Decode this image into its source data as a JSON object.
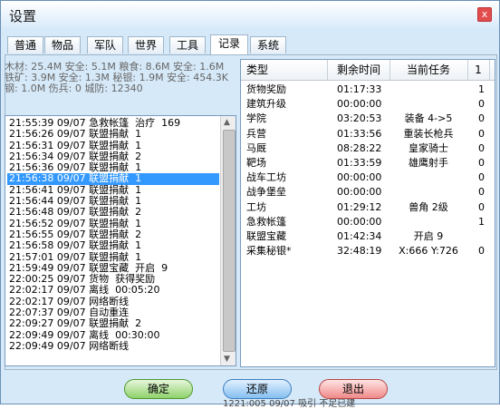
{
  "window": {
    "title": "设置",
    "close_glyph": "x"
  },
  "tabs": [
    {
      "label": "普通",
      "active": false
    },
    {
      "label": "物品",
      "active": false
    },
    {
      "label": "军队",
      "active": false
    },
    {
      "label": "世界",
      "active": false
    },
    {
      "label": "工具",
      "active": false
    },
    {
      "label": "记录",
      "active": true
    },
    {
      "label": "系统",
      "active": false
    }
  ],
  "stats": {
    "line1": "木材: 25.4M 安全: 5.1M  粮食: 8.6M 安全: 1.6M",
    "line2": "铁矿: 3.9M 安全: 1.3M  秘银: 1.9M 安全: 454.3K",
    "line3": "钢: 1.0M  伤兵: 0  城防: 12340"
  },
  "log": {
    "selected_index": 5,
    "entries": [
      "21:55:39 09/07 急救帐篷  治疗  169",
      "21:56:26 09/07 联盟捐献  1",
      "21:56:31 09/07 联盟捐献  1",
      "21:56:34 09/07 联盟捐献  2",
      "21:56:36 09/07 联盟捐献  1",
      "21:56:38 09/07 联盟捐献  1",
      "21:56:41 09/07 联盟捐献  1",
      "21:56:44 09/07 联盟捐献  1",
      "21:56:48 09/07 联盟捐献  2",
      "21:56:52 09/07 联盟捐献  1",
      "21:56:55 09/07 联盟捐献  2",
      "21:56:58 09/07 联盟捐献  1",
      "21:57:01 09/07 联盟捐献  1",
      "21:59:49 09/07 联盟宝藏  开启  9",
      "22:00:25 09/07 货物  获得奖励",
      "22:02:17 09/07 离线  00:05:20",
      "22:02:17 09/07 网络断线",
      "22:07:37 09/07 自动重连",
      "22:09:27 09/07 联盟捐献  2",
      "22:09:49 09/07 离线  00:30:00",
      "22:09:49 09/07 网络断线"
    ]
  },
  "tasks": {
    "headers": [
      "类型",
      "剩余时间",
      "当前任务",
      "1"
    ],
    "rows": [
      {
        "type": "货物奖励",
        "time": "01:17:33",
        "task": "",
        "n": "1"
      },
      {
        "type": "建筑升级",
        "time": "00:00:00",
        "task": "",
        "n": "0"
      },
      {
        "type": "学院",
        "time": "03:20:53",
        "task": "装备 4->5",
        "n": "0"
      },
      {
        "type": "兵营",
        "time": "01:33:56",
        "task": "重装长枪兵",
        "n": "0"
      },
      {
        "type": "马厩",
        "time": "08:28:22",
        "task": "皇家骑士",
        "n": "0"
      },
      {
        "type": "靶场",
        "time": "01:33:59",
        "task": "雄鹰射手",
        "n": "0"
      },
      {
        "type": "战车工坊",
        "time": "00:00:00",
        "task": "",
        "n": "0"
      },
      {
        "type": "战争堡垒",
        "time": "00:00:00",
        "task": "",
        "n": "0"
      },
      {
        "type": "工坊",
        "time": "01:29:12",
        "task": "兽角 2级",
        "n": "0"
      },
      {
        "type": "急救帐篷",
        "time": "00:00:00",
        "task": "",
        "n": "1"
      },
      {
        "type": "联盟宝藏",
        "time": "01:42:34",
        "task": "开启 9",
        "n": ""
      },
      {
        "type": "采集秘银*",
        "time": "32:48:19",
        "task": "X:666 Y:726",
        "n": "0"
      }
    ]
  },
  "buttons": {
    "ok": "确定",
    "reset": "还原",
    "exit": "退出"
  },
  "background_ghost_text": "1221:005 09/07 吸引 不足已建"
}
